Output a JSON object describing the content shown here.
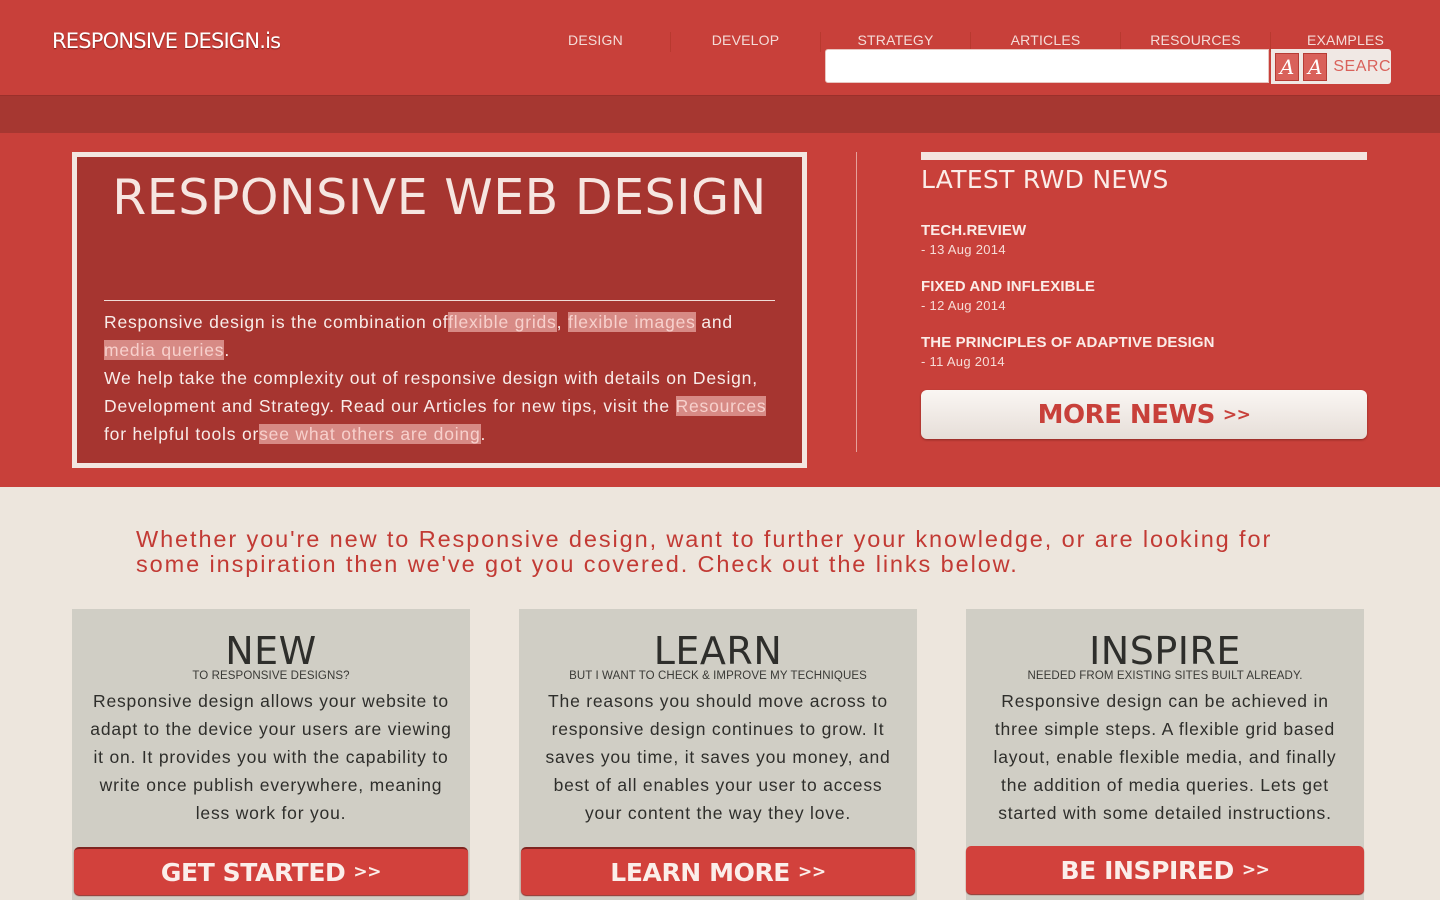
{
  "logo": "RESPONSIVE DESIGN.is",
  "nav": [
    {
      "label": "DESIGN"
    },
    {
      "label": "DEVELOP"
    },
    {
      "label": "STRATEGY"
    },
    {
      "label": "ARTICLES"
    },
    {
      "label": "RESOURCES"
    },
    {
      "label": "EXAMPLES"
    }
  ],
  "search": {
    "value": "",
    "button_label": "SEARC",
    "tool_icons": [
      "font-a-icon",
      "font-a-icon"
    ]
  },
  "hero": {
    "title": "RESPONSIVE WEB DESIGN",
    "intro_prefix": "Responsive design is the combination of",
    "link_flexible_grids": "flexible grids",
    "comma": ",",
    "link_flexible_images": "flexible images",
    "and": "and",
    "link_media_queries": "media queries",
    "period": ".",
    "body": "We help take the complexity out of responsive design with details on Design, Development and Strategy. Read our Articles for new tips, visit the",
    "link_resources": "Resources",
    "helpful_text": "for helpful tools or",
    "link_see_others": "see what others are doing",
    "period2": "."
  },
  "news": {
    "title": "LATEST RWD NEWS",
    "items": [
      {
        "headline": "TECH.REVIEW",
        "date": "- 13 Aug 2014"
      },
      {
        "headline": "FIXED AND INFLEXIBLE",
        "date": "- 12 Aug 2014"
      },
      {
        "headline": "THE PRINCIPLES OF ADAPTIVE DESIGN",
        "date": "- 11 Aug 2014"
      }
    ],
    "more_label": "MORE NEWS",
    "more_arrows": ">>"
  },
  "intro_text": "Whether you're new to Responsive design, want to further your knowledge, or are looking for some inspiration then we've got you covered. Check out the links below.",
  "cards": [
    {
      "title": "NEW",
      "subtitle": "TO RESPONSIVE DESIGNS?",
      "body": "Responsive design allows your website to adapt to the device your users are viewing it on. It provides you with the capability to write once publish everywhere, meaning less work for you.",
      "button": "GET STARTED",
      "arrows": ">>"
    },
    {
      "title": "LEARN",
      "subtitle": "BUT I WANT TO CHECK & IMPROVE MY TECHNIQUES",
      "body": "The reasons you should move across to responsive design continues to grow. It saves you time, it saves you money, and best of all enables your user to access your content the way they love.",
      "button": "LEARN MORE",
      "arrows": ">>"
    },
    {
      "title": "INSPIRE",
      "subtitle": "NEEDED FROM EXISTING SITES BUILT ALREADY.",
      "body": "Responsive design can be achieved in three simple steps. A flexible grid based layout, enable flexible media, and finally the addition of media queries. Lets get started with some detailed instructions.",
      "button": "BE INSPIRED",
      "arrows": ">>"
    }
  ],
  "colors": {
    "brand_red": "#c8403a",
    "dark_red": "#a63530",
    "cream": "#ede6dd",
    "card_grey": "#d0cec5"
  }
}
